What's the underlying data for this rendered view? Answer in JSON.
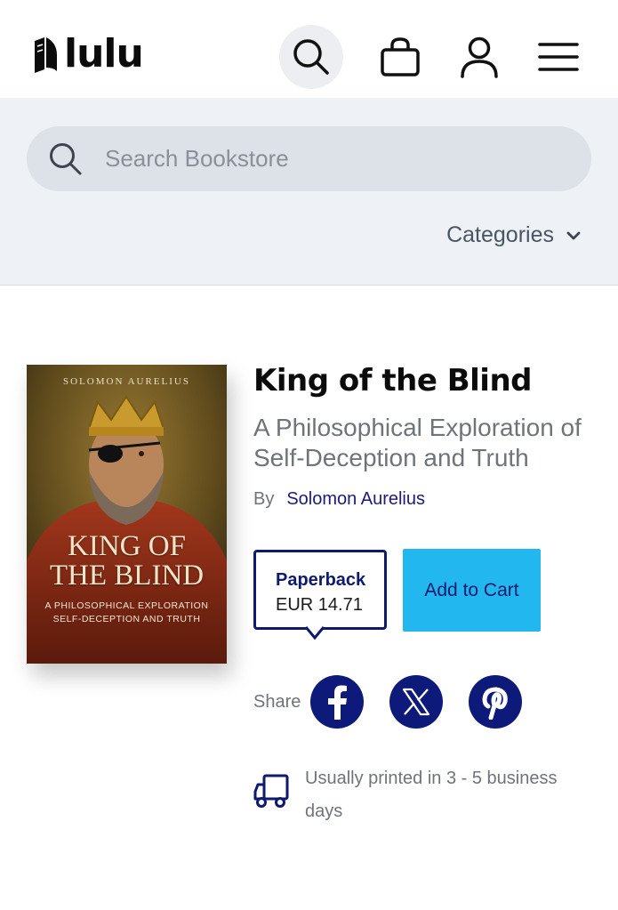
{
  "header": {
    "logo_text": "lulu",
    "icons": [
      "search-icon",
      "shopping-bag-icon",
      "user-icon",
      "hamburger-menu-icon"
    ]
  },
  "search": {
    "placeholder": "Search Bookstore",
    "value": ""
  },
  "categories_label": "Categories",
  "book": {
    "cover": {
      "author": "SOLOMON AURELIUS",
      "title_line1": "KING OF",
      "title_line2": "THE BLIND",
      "subtitle_line1": "A PHILOSOPHICAL EXPLORATION",
      "subtitle_line2": "SELF-DECEPTION AND TRUTH"
    },
    "title": "King of the Blind",
    "subtitle": "A Philosophical Exploration of Self-Deception and Truth",
    "by_label": "By",
    "author": "Solomon Aurelius"
  },
  "format": {
    "name": "Paperback",
    "price": "EUR 14.71"
  },
  "add_to_cart_label": "Add to Cart",
  "share": {
    "label": "Share",
    "networks": [
      "facebook-icon",
      "x-icon",
      "pinterest-icon"
    ]
  },
  "shipping": {
    "text": "Usually printed in 3 - 5 business days"
  },
  "colors": {
    "navy": "#0d1a6e",
    "accent_blue": "#22b7ee",
    "band_bg": "#eef1f6"
  }
}
